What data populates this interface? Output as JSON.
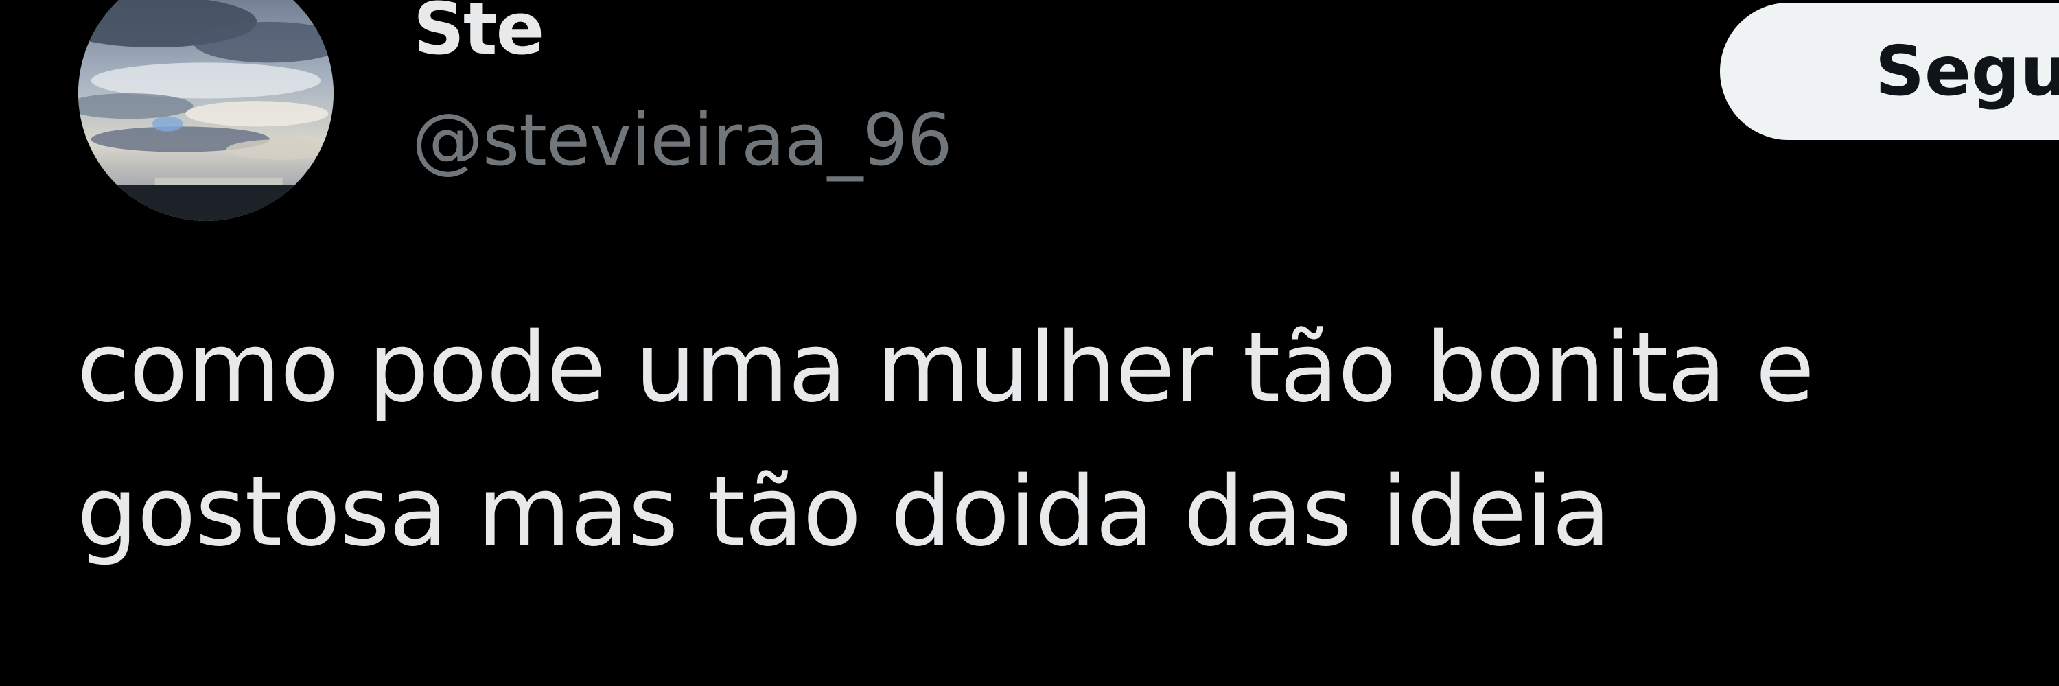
{
  "tweet": {
    "author": {
      "display_name": "Ste",
      "handle": "@stevieiraa_96",
      "avatar": "sky-clouds-photo"
    },
    "follow_button": {
      "label": "Segu"
    },
    "text": "como pode uma mulher tão bonita e gostosa mas tão doida das ideia"
  },
  "colors": {
    "background": "#000000",
    "primary_text": "#e7e9ea",
    "secondary_text": "#71767b",
    "button_bg": "#eff3f4",
    "button_text": "#0f1419"
  }
}
